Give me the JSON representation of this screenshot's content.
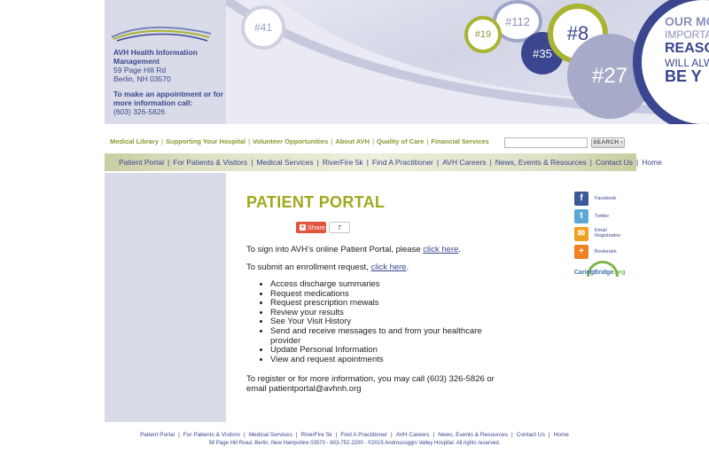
{
  "header": {
    "org_name": "AVH Health Information Management",
    "address_line1": "59 Page Hill Rd",
    "address_line2": "Berlin, NH 03570",
    "call_prompt": "To make an appointment or for more information call:",
    "phone": "(603) 326-5826",
    "bubbles": [
      "#41",
      "#112",
      "#19",
      "#35",
      "#8",
      "#27"
    ],
    "tagline": [
      "OUR MO",
      "IMPORTA",
      "REASO",
      "WILL ALW",
      "BE Y"
    ]
  },
  "utility_nav": {
    "items": [
      "Medical Library",
      "Supporting Your Hospital",
      "Volunteer Opportunities",
      "About AVH",
      "Quality of Care",
      "Financial Services"
    ],
    "search_placeholder": "",
    "search_button": "SEARCH ›"
  },
  "main_nav": {
    "items": [
      "Patient Portal",
      "For Patients & Visitors",
      "Medical Services",
      "RiverFire 5k",
      "Find A Practitioner",
      "AVH Careers",
      "News, Events & Resources",
      "Contact Us",
      "Home"
    ]
  },
  "page": {
    "title": "PATIENT PORTAL",
    "share_label": "Share",
    "share_count": "7",
    "signin_text": "To sign into AVH’s online Patient Portal, please ",
    "signin_link": "click here",
    "enroll_text": "To submit an enrollment request, ",
    "enroll_link": "click here",
    "features": [
      "Access discharge summaries",
      "Request medications",
      "Request prescription rnewals",
      "Review your results",
      "See Your Visit History",
      "Send and receive messages to and from your healthcare provider",
      "Update Personal Information",
      "View and request apointments"
    ],
    "register_text": "To register or for more information, you may call (603) 326-5826 or email patientportal@avhnh.org"
  },
  "social": {
    "facebook": "Facebook",
    "twitter": "Twitter",
    "email": "Email Registration",
    "bookmark": "Bookmark",
    "caringbridge": "CaringBridge",
    "caringbridge_suffix": ".org"
  },
  "footer": {
    "items": [
      "Patient Portal",
      "For Patients & Visitors",
      "Medical Services",
      "RiverFire 5k",
      "Find A Practitioner",
      "AVH Careers",
      "News, Events & Resources",
      "Contact Us",
      "Home"
    ],
    "copyright": "59 Page Hill Road, Berlin, New Hampshire 03570 - 603-752-2200 - ©2015 Androscoggin Valley Hospital. All rights reserved."
  },
  "colors": {
    "navy": "#3a468f",
    "olive": "#a0a81e",
    "lavender": "#d9dbe9"
  }
}
